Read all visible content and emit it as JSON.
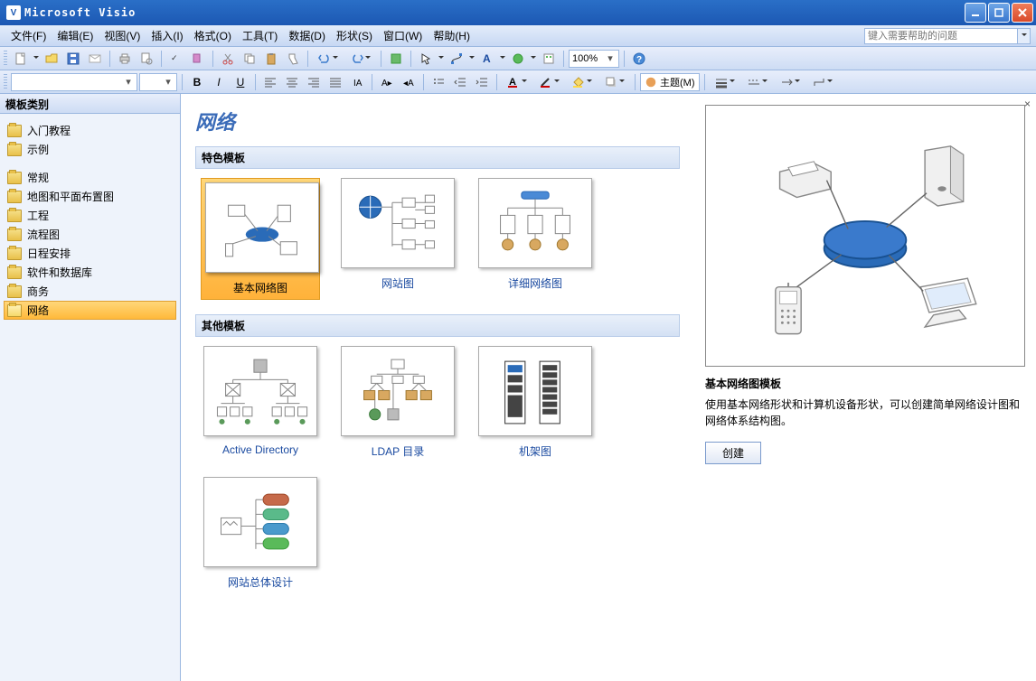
{
  "app": {
    "title": "Microsoft Visio"
  },
  "menu": {
    "items": [
      "文件(F)",
      "编辑(E)",
      "视图(V)",
      "插入(I)",
      "格式(O)",
      "工具(T)",
      "数据(D)",
      "形状(S)",
      "窗口(W)",
      "帮助(H)"
    ],
    "help_placeholder": "键入需要帮助的问题"
  },
  "toolbar": {
    "zoom": "100%",
    "font": "",
    "fontsize": "",
    "theme_label": "主题(M)"
  },
  "sidebar": {
    "header": "模板类别",
    "group1": [
      "入门教程",
      "示例"
    ],
    "group2": [
      "常规",
      "地图和平面布置图",
      "工程",
      "流程图",
      "日程安排",
      "软件和数据库",
      "商务",
      "网络"
    ],
    "selected": "网络"
  },
  "content": {
    "category_title": "网络",
    "section1": "特色模板",
    "section2": "其他模板",
    "featured": [
      {
        "name": "基本网络图",
        "selected": true
      },
      {
        "name": "网站图"
      },
      {
        "name": "详细网络图"
      }
    ],
    "other": [
      {
        "name": "Active Directory"
      },
      {
        "name": "LDAP 目录"
      },
      {
        "name": "机架图"
      },
      {
        "name": "网站总体设计"
      }
    ]
  },
  "preview": {
    "title": "基本网络图模板",
    "desc": "使用基本网络形状和计算机设备形状，可以创建简单网络设计图和网络体系结构图。",
    "create": "创建"
  }
}
